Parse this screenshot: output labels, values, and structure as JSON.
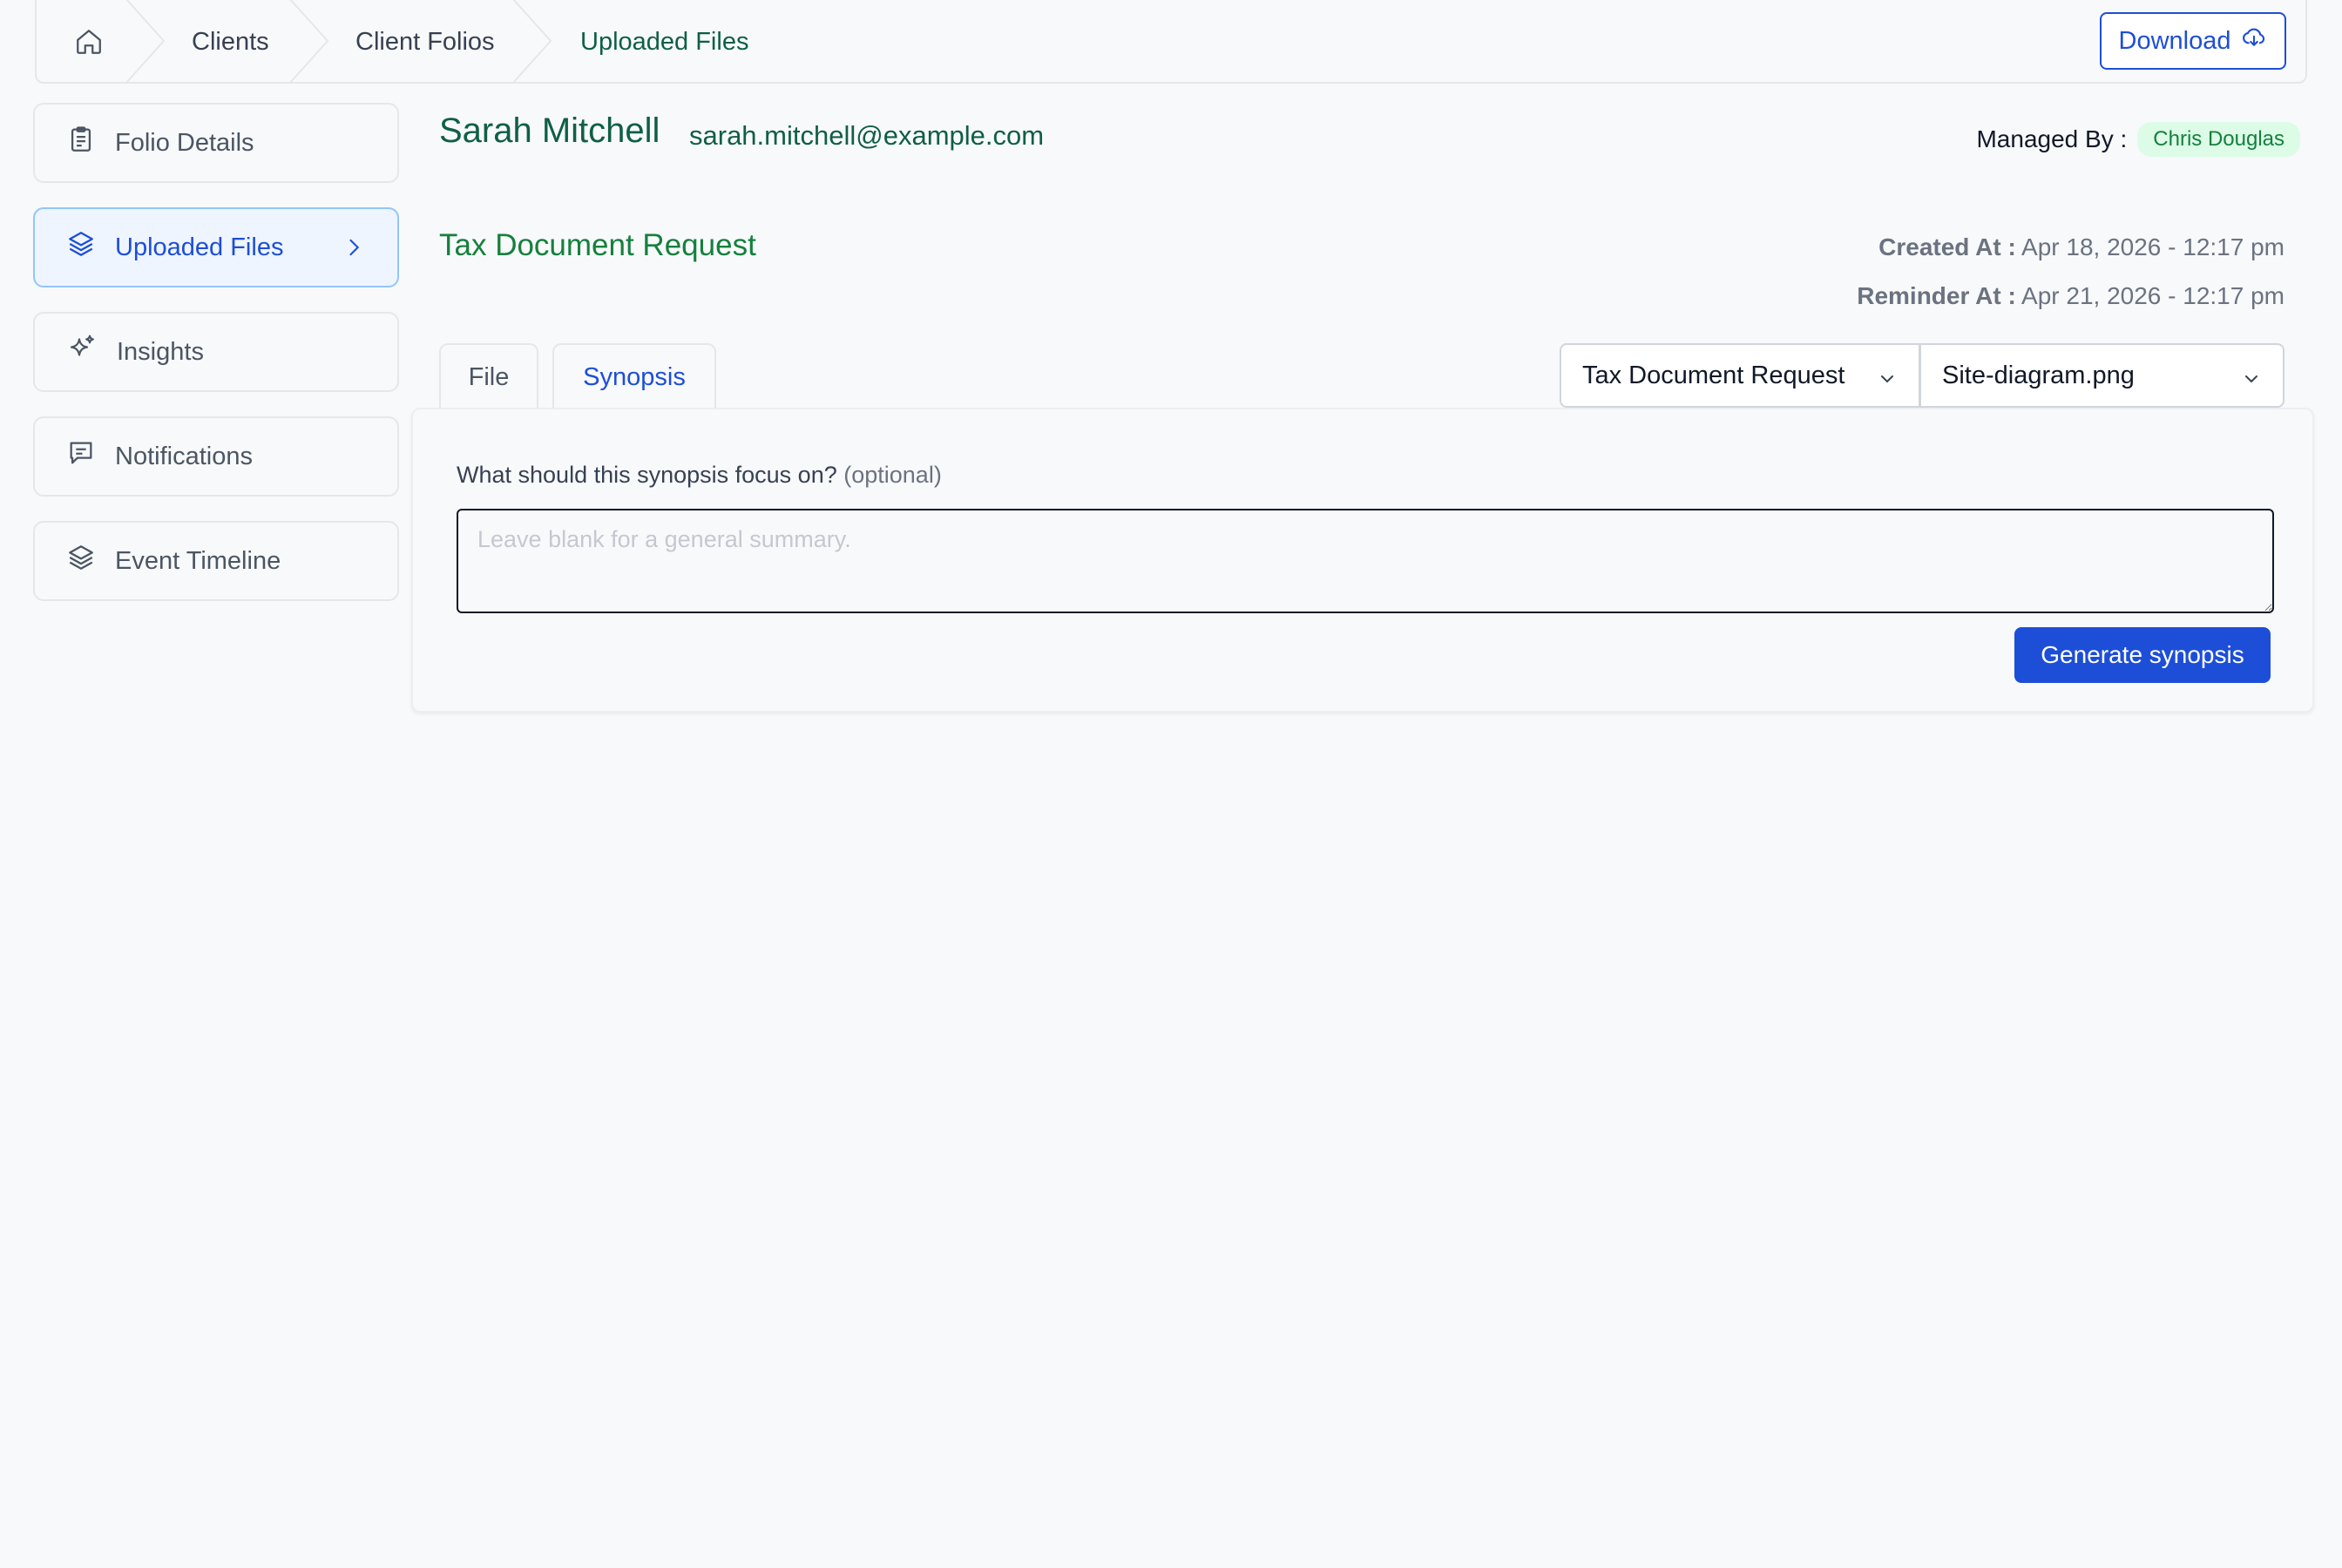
{
  "breadcrumb": {
    "home_icon": "home-icon",
    "items": [
      "Clients",
      "Client Folios",
      "Uploaded Files"
    ]
  },
  "toolbar": {
    "download_label": "Download",
    "download_icon": "cloud-download-icon"
  },
  "sidebar": {
    "items": [
      {
        "label": "Folio Details",
        "icon": "clipboard-icon"
      },
      {
        "label": "Uploaded Files",
        "icon": "layers-icon",
        "active": true
      },
      {
        "label": "Insights",
        "icon": "sparkle-icon"
      },
      {
        "label": "Notifications",
        "icon": "message-icon"
      },
      {
        "label": "Event Timeline",
        "icon": "layers-icon"
      }
    ]
  },
  "client": {
    "name": "Sarah Mitchell",
    "email": "sarah.mitchell@example.com",
    "managed_by_label": "Managed By :",
    "managed_by": "Chris Douglas"
  },
  "request": {
    "title": "Tax Document Request",
    "created_label": "Created At :",
    "created_value": "Apr 18, 2026 - 12:17 pm",
    "reminder_label": "Reminder At :",
    "reminder_value": "Apr 21, 2026 - 12:17 pm"
  },
  "tabs": [
    {
      "label": "File"
    },
    {
      "label": "Synopsis",
      "active": true
    }
  ],
  "selects": {
    "request": "Tax Document Request",
    "file": "Site-diagram.png"
  },
  "synopsis": {
    "question": "What should this synopsis focus on?",
    "optional": "(optional)",
    "placeholder": "Leave blank for a general summary.",
    "value": "",
    "button_label": "Generate synopsis"
  },
  "colors": {
    "accent_blue": "#1d4ed8",
    "brand_green": "#0f5f45",
    "badge_bg": "#dcfce7"
  }
}
